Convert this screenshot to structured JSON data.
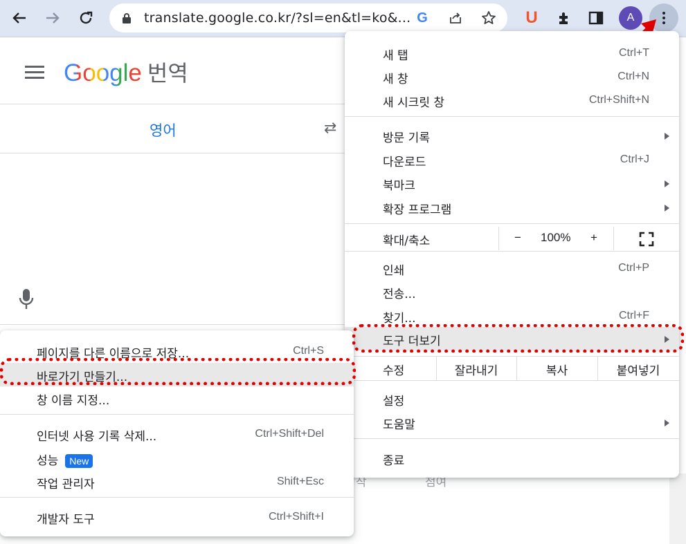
{
  "browser": {
    "url": "translate.google.co.kr/?sl=en&tl=ko&...",
    "avatar_letter": "A",
    "extension_letter": "U"
  },
  "translate": {
    "brand": "Google",
    "title": "번역",
    "source_language": "영어",
    "behind_text_1": "작",
    "behind_text_2": "첨여"
  },
  "main_menu": {
    "new_tab": {
      "label": "새 탭",
      "shortcut": "Ctrl+T"
    },
    "new_window": {
      "label": "새 창",
      "shortcut": "Ctrl+N"
    },
    "incognito": {
      "label": "새 시크릿 창",
      "shortcut": "Ctrl+Shift+N"
    },
    "history": {
      "label": "방문 기록"
    },
    "downloads": {
      "label": "다운로드",
      "shortcut": "Ctrl+J"
    },
    "bookmarks": {
      "label": "북마크"
    },
    "extensions": {
      "label": "확장 프로그램"
    },
    "zoom": {
      "label": "확대/축소",
      "minus": "−",
      "value": "100%",
      "plus": "+"
    },
    "print": {
      "label": "인쇄",
      "shortcut": "Ctrl+P"
    },
    "cast": {
      "label": "전송..."
    },
    "find": {
      "label": "찾기...",
      "shortcut": "Ctrl+F"
    },
    "more_tools": {
      "label": "도구 더보기"
    },
    "edit": {
      "label": "수정",
      "cut": "잘라내기",
      "copy": "복사",
      "paste": "붙여넣기"
    },
    "settings": {
      "label": "설정"
    },
    "help": {
      "label": "도움말"
    },
    "exit": {
      "label": "종료"
    }
  },
  "sub_menu": {
    "save_as": {
      "label": "페이지를 다른 이름으로 저장...",
      "shortcut": "Ctrl+S"
    },
    "create_shortcut": {
      "label": "바로가기 만들기..."
    },
    "name_window": {
      "label": "창 이름 지정..."
    },
    "clear_data": {
      "label": "인터넷 사용 기록 삭제...",
      "shortcut": "Ctrl+Shift+Del"
    },
    "performance": {
      "label": "성능",
      "badge": "New"
    },
    "task_manager": {
      "label": "작업 관리자",
      "shortcut": "Shift+Esc"
    },
    "dev_tools": {
      "label": "개발자 도구",
      "shortcut": "Ctrl+Shift+I"
    }
  },
  "colors": {
    "accent": "#1a73e8",
    "highlight": "#e00000",
    "toolbar": "#dfe6f3"
  }
}
